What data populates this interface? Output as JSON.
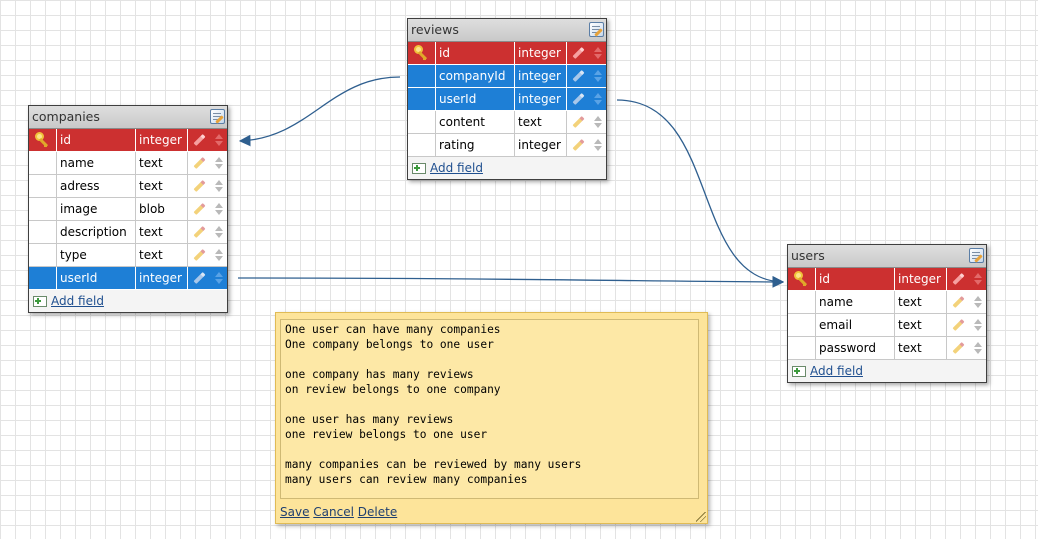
{
  "tables": {
    "companies": {
      "title": "companies",
      "add_field": "Add field",
      "fields": [
        {
          "name": "id",
          "type": "integer",
          "kind": "pk"
        },
        {
          "name": "name",
          "type": "text",
          "kind": "plain"
        },
        {
          "name": "adress",
          "type": "text",
          "kind": "plain"
        },
        {
          "name": "image",
          "type": "blob",
          "kind": "plain"
        },
        {
          "name": "description",
          "type": "text",
          "kind": "plain"
        },
        {
          "name": "type",
          "type": "text",
          "kind": "plain"
        },
        {
          "name": "userId",
          "type": "integer",
          "kind": "fk"
        }
      ]
    },
    "reviews": {
      "title": "reviews",
      "add_field": "Add field",
      "fields": [
        {
          "name": "id",
          "type": "integer",
          "kind": "pk"
        },
        {
          "name": "companyId",
          "type": "integer",
          "kind": "fk"
        },
        {
          "name": "userId",
          "type": "integer",
          "kind": "fk"
        },
        {
          "name": "content",
          "type": "text",
          "kind": "plain"
        },
        {
          "name": "rating",
          "type": "integer",
          "kind": "plain"
        }
      ]
    },
    "users": {
      "title": "users",
      "add_field": "Add field",
      "fields": [
        {
          "name": "id",
          "type": "integer",
          "kind": "pk"
        },
        {
          "name": "name",
          "type": "text",
          "kind": "plain"
        },
        {
          "name": "email",
          "type": "text",
          "kind": "plain"
        },
        {
          "name": "password",
          "type": "text",
          "kind": "plain"
        }
      ]
    }
  },
  "note": {
    "text": "One user can have many companies\nOne company belongs to one user\n\none company has many reviews\non review belongs to one company\n\none user has many reviews\none review belongs to one user\n\nmany companies can be reviewed by many users\nmany users can review many companies",
    "save": "Save",
    "cancel": "Cancel",
    "delete": "Delete"
  },
  "colors": {
    "primary_key": "#cc3030",
    "foreign_key": "#1e7fd6",
    "connector": "#2f5f8f",
    "note_background": "#fde49a"
  },
  "icons": {
    "primary_key": "key-icon",
    "edit_field": "pencil-icon",
    "reorder_field": "updown-icon",
    "edit_table": "edit-table-icon",
    "add_field": "add-field-icon"
  }
}
